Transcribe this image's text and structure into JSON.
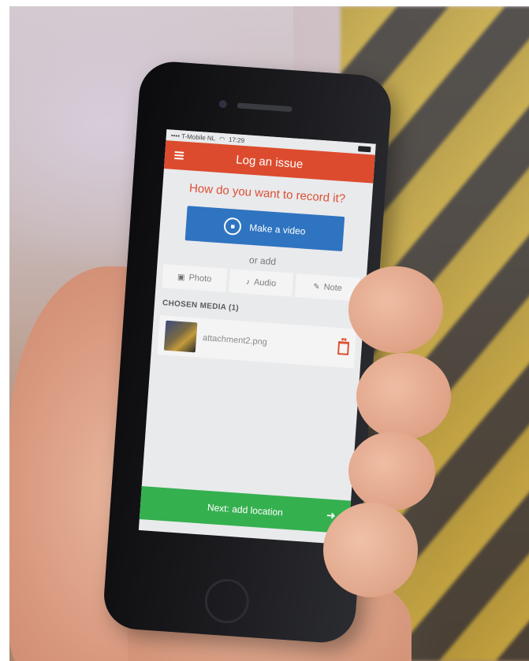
{
  "status": {
    "carrier": "•••• T-Mobile NL",
    "wifi": "wifi-icon",
    "time": "17:29",
    "battery": "battery-icon"
  },
  "appbar": {
    "title": "Log an issue",
    "menu_icon": "hamburger-menu-icon"
  },
  "main": {
    "question": "How do you want to record it?",
    "video_button": {
      "label": "Make a video",
      "icon": "video-camera-icon"
    },
    "or_add": "or add",
    "media_options": [
      {
        "label": "Photo",
        "icon": "camera-icon"
      },
      {
        "label": "Audio",
        "icon": "microphone-icon"
      },
      {
        "label": "Note",
        "icon": "pencil-icon"
      }
    ],
    "chosen_media_title": "CHOSEN MEDIA (1)",
    "attachments": [
      {
        "filename": "attachment2.png",
        "delete_icon": "trash-icon"
      }
    ],
    "next_button": {
      "label": "Next: add location",
      "icon": "arrow-right-icon"
    }
  },
  "colors": {
    "accent": "#dc4b2d",
    "primary_button": "#2f74c0",
    "success": "#35b04f"
  }
}
